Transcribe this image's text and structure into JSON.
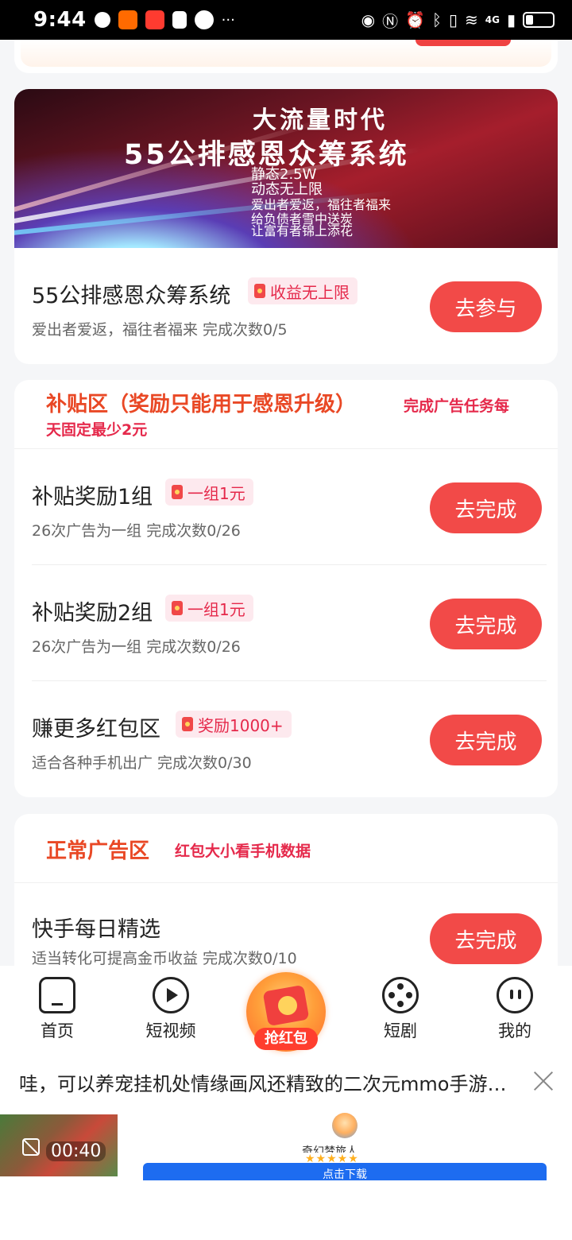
{
  "status_bar": {
    "time": "9:44",
    "network": "4G",
    "more": "···"
  },
  "banner": {
    "headline": "大流量时代",
    "system_name": "55公排感恩众筹系统",
    "lines": [
      "静态2.5W",
      "动态无上限",
      "爱出者爱返，福往者福来",
      "给负债者雪中送炭",
      "让富有者锦上添花"
    ]
  },
  "featured_task": {
    "title": "55公排感恩众筹系统",
    "tag": "收益无上限",
    "subtitle": "爱出者爱返，福往者福来  完成次数0/5",
    "button": "去参与"
  },
  "subsidy_section": {
    "title": "补贴区（奖励只能用于感恩升级）",
    "note_line1": "完成广告任务每",
    "note_line2": "天固定最少2元",
    "tasks": [
      {
        "title": "补贴奖励1组",
        "tag": "一组1元",
        "subtitle": "26次广告为一组  完成次数0/26",
        "button": "去完成"
      },
      {
        "title": "补贴奖励2组",
        "tag": "一组1元",
        "subtitle": "26次广告为一组  完成次数0/26",
        "button": "去完成"
      },
      {
        "title": "赚更多红包区",
        "tag": "奖励1000+",
        "subtitle": "适合各种手机出广  完成次数0/30",
        "button": "去完成"
      }
    ]
  },
  "normal_ad_section": {
    "title": "正常广告区",
    "note": "红包大小看手机数据",
    "tasks": [
      {
        "title": "快手每日精选",
        "subtitle": "适当转化可提高金币收益  完成次数0/10",
        "button": "去完成"
      }
    ]
  },
  "bottom_nav": {
    "items": [
      {
        "label": "首页",
        "icon": "home-icon"
      },
      {
        "label": "短视频",
        "icon": "play-icon"
      },
      {
        "label": "抢红包",
        "icon": "red-packet-icon"
      },
      {
        "label": "短剧",
        "icon": "film-reel-icon"
      },
      {
        "label": "我的",
        "icon": "face-icon"
      }
    ]
  },
  "ad": {
    "text": "哇，可以养宠挂机处情缘画风还精致的二次元mmo手游…",
    "video_time": "00:40",
    "app_name": "奇幻梦旅人",
    "stars": "★★★★★",
    "download": "点击下载"
  },
  "colors": {
    "accent_red": "#f24a48",
    "section_orange": "#e94825",
    "tag_red": "#e5294b"
  }
}
